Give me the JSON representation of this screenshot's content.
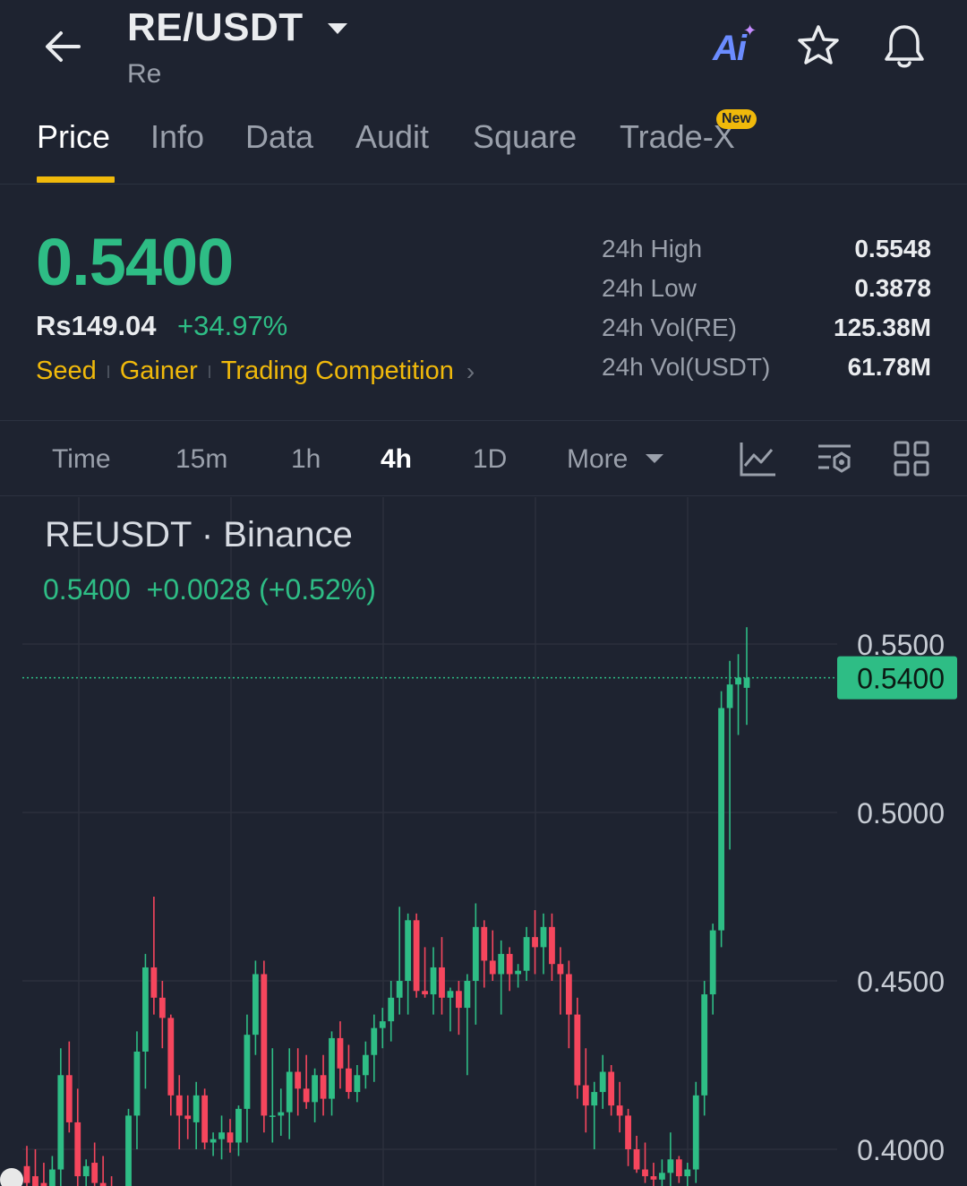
{
  "header": {
    "pair": "RE/USDT",
    "subtitle": "Re",
    "ai_label": "Ai",
    "icons": {
      "back": "arrow-left-icon",
      "caret": "caret-down-icon",
      "star": "star-icon",
      "bell": "bell-icon"
    }
  },
  "tabs": [
    {
      "label": "Price",
      "active": true
    },
    {
      "label": "Info"
    },
    {
      "label": "Data"
    },
    {
      "label": "Audit"
    },
    {
      "label": "Square"
    },
    {
      "label": "Trade-X"
    }
  ],
  "new_badge": "New",
  "price": {
    "last": "0.5400",
    "fiat": "Rs149.04",
    "change_pct": "+34.97%",
    "tags": [
      "Seed",
      "Gainer",
      "Trading Competition"
    ]
  },
  "stats": [
    {
      "label": "24h High",
      "value": "0.5548"
    },
    {
      "label": "24h Low",
      "value": "0.3878"
    },
    {
      "label": "24h Vol(RE)",
      "value": "125.38M"
    },
    {
      "label": "24h Vol(USDT)",
      "value": "61.78M"
    }
  ],
  "intervals": [
    {
      "label": "Time"
    },
    {
      "label": "15m"
    },
    {
      "label": "1h"
    },
    {
      "label": "4h",
      "active": true
    },
    {
      "label": "1D"
    },
    {
      "label": "More"
    }
  ],
  "tool_icons": [
    "indicator-chart-icon",
    "chart-settings-icon",
    "grid-layout-icon"
  ],
  "chart": {
    "title": "REUSDT · Binance",
    "ohlc_price": "0.5400",
    "ohlc_change": "+0.0028 (+0.52%)",
    "current_label": "0.5400",
    "colors": {
      "up": "#2ebd85",
      "down": "#f6465d",
      "bg": "#1e2330",
      "grid": "#2b303c"
    }
  },
  "chart_data": {
    "type": "candlestick",
    "title": "",
    "xlabel": "",
    "ylabel": "",
    "ylim": [
      0.39,
      0.56
    ],
    "yticks": [
      "0.5500",
      "0.5000",
      "0.4500",
      "0.4000"
    ],
    "ytick_values": [
      0.55,
      0.5,
      0.45,
      0.4
    ],
    "current_price": 0.54,
    "grid": true,
    "candles": [
      [
        0.395,
        0.401,
        0.388,
        0.39
      ],
      [
        0.392,
        0.4,
        0.385,
        0.388
      ],
      [
        0.39,
        0.396,
        0.384,
        0.386
      ],
      [
        0.388,
        0.398,
        0.386,
        0.394
      ],
      [
        0.394,
        0.43,
        0.388,
        0.422
      ],
      [
        0.422,
        0.432,
        0.405,
        0.408
      ],
      [
        0.408,
        0.418,
        0.386,
        0.392
      ],
      [
        0.392,
        0.397,
        0.385,
        0.395
      ],
      [
        0.396,
        0.402,
        0.386,
        0.39
      ],
      [
        0.39,
        0.398,
        0.384,
        0.387
      ],
      [
        0.387,
        0.392,
        0.385,
        0.386
      ],
      [
        0.385,
        0.389,
        0.383,
        0.388
      ],
      [
        0.388,
        0.412,
        0.386,
        0.41
      ],
      [
        0.41,
        0.435,
        0.4,
        0.429
      ],
      [
        0.429,
        0.458,
        0.418,
        0.454
      ],
      [
        0.454,
        0.475,
        0.44,
        0.445
      ],
      [
        0.445,
        0.45,
        0.43,
        0.439
      ],
      [
        0.439,
        0.44,
        0.41,
        0.416
      ],
      [
        0.416,
        0.422,
        0.4,
        0.41
      ],
      [
        0.41,
        0.416,
        0.403,
        0.409
      ],
      [
        0.408,
        0.42,
        0.4,
        0.416
      ],
      [
        0.416,
        0.418,
        0.4,
        0.402
      ],
      [
        0.402,
        0.405,
        0.398,
        0.403
      ],
      [
        0.403,
        0.41,
        0.397,
        0.405
      ],
      [
        0.405,
        0.409,
        0.399,
        0.402
      ],
      [
        0.402,
        0.413,
        0.398,
        0.412
      ],
      [
        0.412,
        0.44,
        0.402,
        0.434
      ],
      [
        0.434,
        0.456,
        0.428,
        0.452
      ],
      [
        0.452,
        0.456,
        0.405,
        0.41
      ],
      [
        0.41,
        0.43,
        0.402,
        0.41
      ],
      [
        0.41,
        0.418,
        0.404,
        0.411
      ],
      [
        0.411,
        0.43,
        0.403,
        0.423
      ],
      [
        0.423,
        0.43,
        0.41,
        0.418
      ],
      [
        0.418,
        0.428,
        0.412,
        0.414
      ],
      [
        0.414,
        0.424,
        0.408,
        0.422
      ],
      [
        0.422,
        0.428,
        0.41,
        0.415
      ],
      [
        0.415,
        0.435,
        0.41,
        0.433
      ],
      [
        0.433,
        0.438,
        0.418,
        0.424
      ],
      [
        0.424,
        0.431,
        0.415,
        0.417
      ],
      [
        0.417,
        0.425,
        0.414,
        0.422
      ],
      [
        0.422,
        0.432,
        0.418,
        0.428
      ],
      [
        0.428,
        0.44,
        0.42,
        0.436
      ],
      [
        0.436,
        0.442,
        0.43,
        0.438
      ],
      [
        0.438,
        0.45,
        0.432,
        0.445
      ],
      [
        0.445,
        0.472,
        0.44,
        0.45
      ],
      [
        0.45,
        0.47,
        0.44,
        0.468
      ],
      [
        0.468,
        0.47,
        0.445,
        0.447
      ],
      [
        0.447,
        0.46,
        0.445,
        0.446
      ],
      [
        0.446,
        0.46,
        0.44,
        0.454
      ],
      [
        0.454,
        0.463,
        0.44,
        0.445
      ],
      [
        0.445,
        0.448,
        0.435,
        0.447
      ],
      [
        0.447,
        0.45,
        0.434,
        0.442
      ],
      [
        0.442,
        0.452,
        0.422,
        0.45
      ],
      [
        0.45,
        0.473,
        0.437,
        0.466
      ],
      [
        0.466,
        0.468,
        0.448,
        0.456
      ],
      [
        0.456,
        0.465,
        0.45,
        0.452
      ],
      [
        0.452,
        0.462,
        0.44,
        0.458
      ],
      [
        0.458,
        0.46,
        0.447,
        0.452
      ],
      [
        0.452,
        0.455,
        0.448,
        0.453
      ],
      [
        0.453,
        0.466,
        0.45,
        0.463
      ],
      [
        0.463,
        0.471,
        0.452,
        0.46
      ],
      [
        0.46,
        0.47,
        0.452,
        0.466
      ],
      [
        0.466,
        0.47,
        0.45,
        0.455
      ],
      [
        0.455,
        0.46,
        0.44,
        0.452
      ],
      [
        0.452,
        0.456,
        0.43,
        0.44
      ],
      [
        0.44,
        0.445,
        0.415,
        0.419
      ],
      [
        0.419,
        0.43,
        0.405,
        0.413
      ],
      [
        0.413,
        0.42,
        0.4,
        0.417
      ],
      [
        0.417,
        0.428,
        0.412,
        0.423
      ],
      [
        0.423,
        0.425,
        0.41,
        0.413
      ],
      [
        0.413,
        0.42,
        0.405,
        0.41
      ],
      [
        0.41,
        0.412,
        0.395,
        0.4
      ],
      [
        0.4,
        0.404,
        0.393,
        0.394
      ],
      [
        0.394,
        0.402,
        0.39,
        0.392
      ],
      [
        0.392,
        0.396,
        0.388,
        0.391
      ],
      [
        0.391,
        0.397,
        0.387,
        0.393
      ],
      [
        0.393,
        0.405,
        0.389,
        0.397
      ],
      [
        0.397,
        0.398,
        0.39,
        0.392
      ],
      [
        0.392,
        0.396,
        0.385,
        0.394
      ],
      [
        0.394,
        0.42,
        0.39,
        0.416
      ],
      [
        0.416,
        0.45,
        0.41,
        0.446
      ],
      [
        0.446,
        0.467,
        0.44,
        0.465
      ],
      [
        0.465,
        0.536,
        0.46,
        0.531
      ],
      [
        0.531,
        0.545,
        0.489,
        0.538
      ],
      [
        0.538,
        0.547,
        0.523,
        0.54
      ],
      [
        0.537,
        0.555,
        0.526,
        0.54
      ]
    ]
  }
}
